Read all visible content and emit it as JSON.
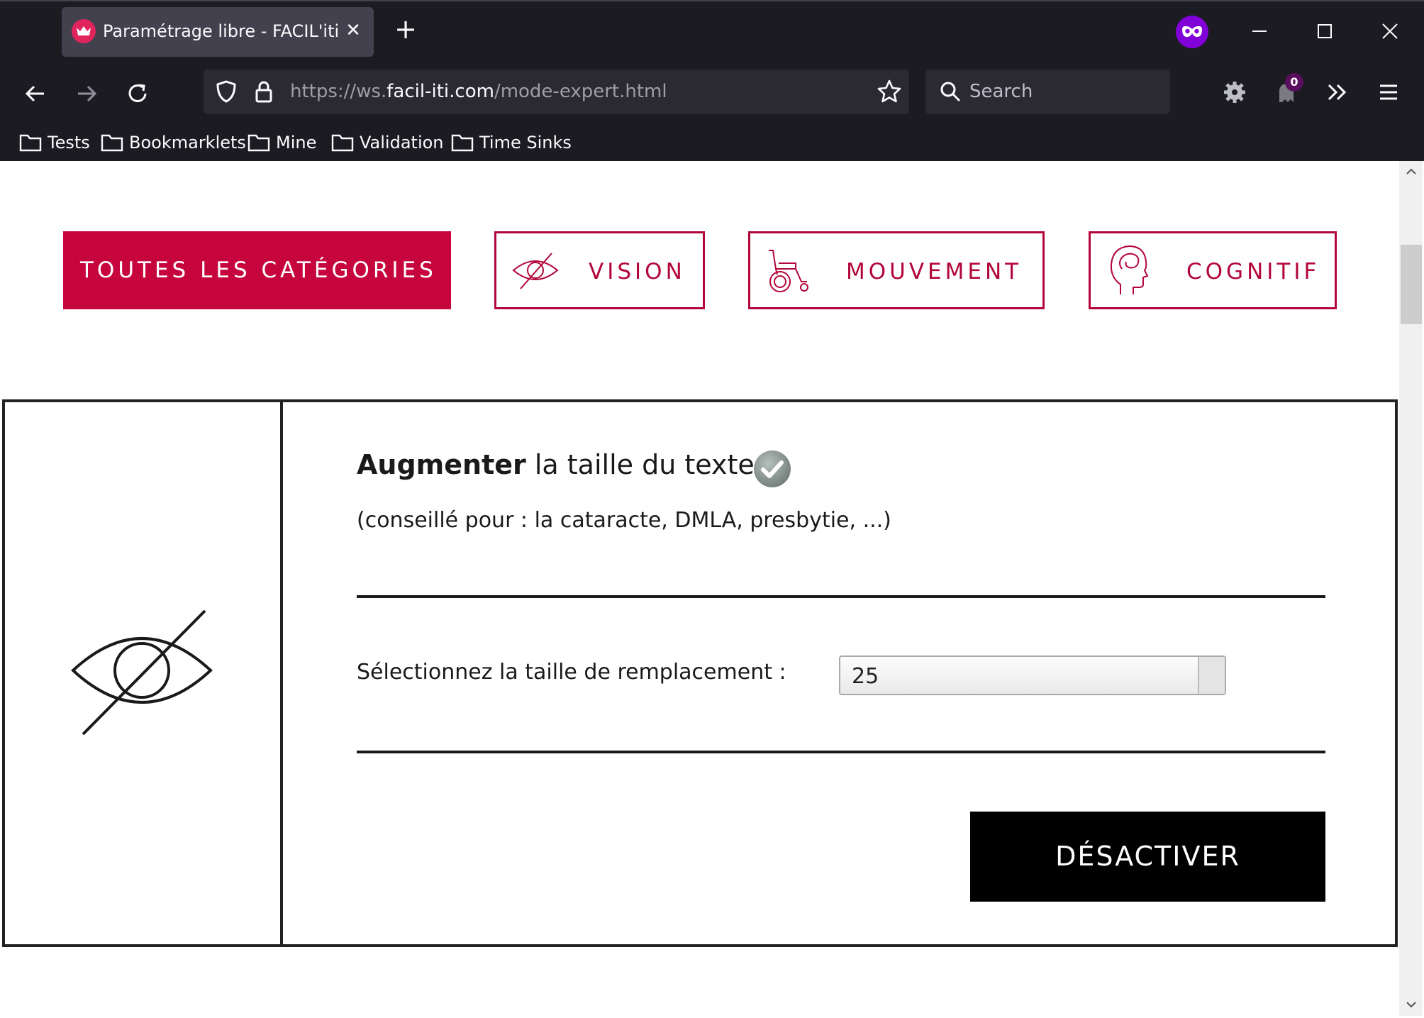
{
  "browser": {
    "tab": {
      "title": "Paramétrage libre - FACIL'iti",
      "close_label": "✕"
    },
    "new_tab_label": "+",
    "url": {
      "prefix": "https://ws.",
      "domain": "facil-iti.com",
      "path": "/mode-expert.html"
    },
    "search_placeholder": "Search",
    "notification_count": "0",
    "bookmarks": [
      {
        "label": "Tests"
      },
      {
        "label": "Bookmarklets"
      },
      {
        "label": "Mine"
      },
      {
        "label": "Validation"
      },
      {
        "label": "Time Sinks"
      }
    ],
    "icons": [
      "facil-iti-favicon",
      "private-browsing-icon",
      "minimize-icon",
      "maximize-icon",
      "close-window-icon",
      "back-icon",
      "forward-icon",
      "reload-icon",
      "tracking-shield-icon",
      "lock-icon",
      "bookmark-star-icon",
      "search-icon",
      "extension-gear-icon",
      "extension-ghost-icon",
      "overflow-chevrons-icon",
      "hamburger-menu-icon",
      "folder-icon"
    ]
  },
  "categories": {
    "all": "TOUTES LES CATÉGORIES",
    "vision": "VISION",
    "movement": "MOUVEMENT",
    "cognitive": "COGNITIF"
  },
  "setting": {
    "title_bold": "Augmenter",
    "title_rest": " la taille du texte",
    "subtitle": "(conseillé pour : la cataracte, DMLA, presbytie, ...)",
    "size_label": "Sélectionnez la taille de remplacement :",
    "size_value": "25",
    "deactivate_label": "DÉSACTIVER"
  },
  "colors": {
    "brand_red": "#c7053d",
    "chrome_bg": "#1c1b22",
    "private_purple": "#8000d7"
  }
}
